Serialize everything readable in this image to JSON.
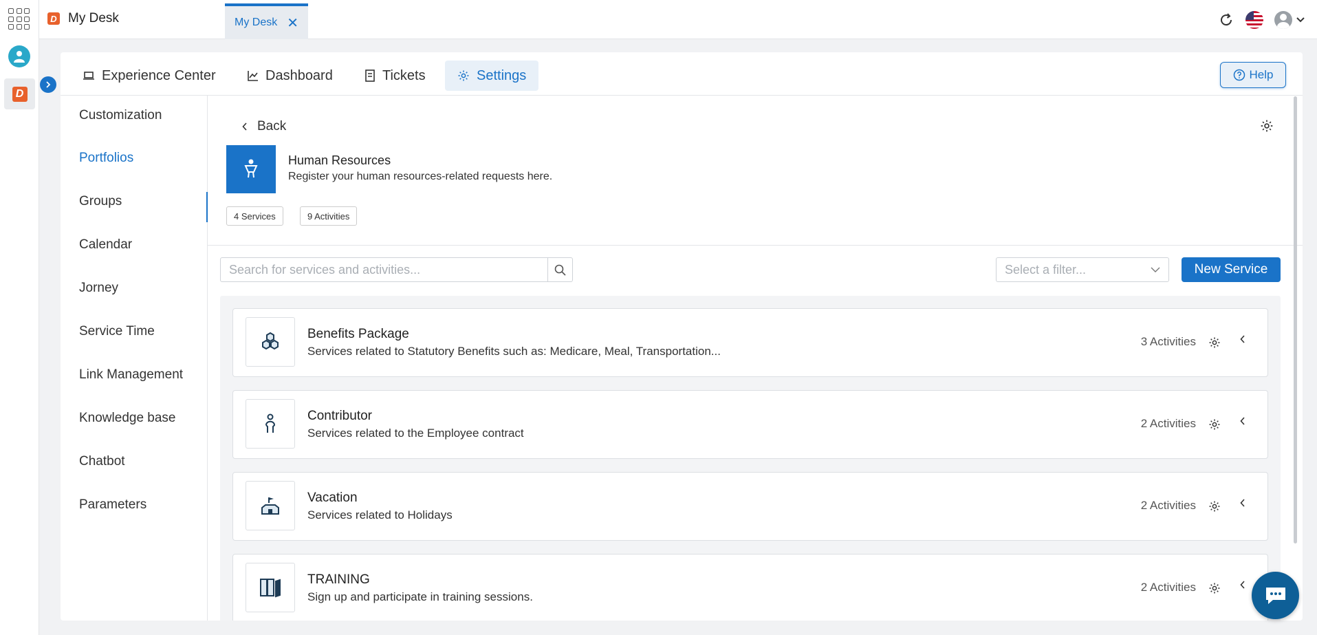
{
  "app": {
    "title": "My Desk",
    "tab_label": "My Desk"
  },
  "nav": {
    "items": [
      {
        "label": "Experience Center"
      },
      {
        "label": "Dashboard"
      },
      {
        "label": "Tickets"
      },
      {
        "label": "Settings"
      }
    ],
    "help_label": "Help"
  },
  "sidebar": {
    "items": [
      {
        "label": "Customization"
      },
      {
        "label": "Portfolios"
      },
      {
        "label": "Groups"
      },
      {
        "label": "Calendar"
      },
      {
        "label": "Jorney"
      },
      {
        "label": "Service Time"
      },
      {
        "label": "Link Management"
      },
      {
        "label": "Knowledge base"
      },
      {
        "label": "Chatbot"
      },
      {
        "label": "Parameters"
      }
    ],
    "active": "Portfolios"
  },
  "portfolio": {
    "back_label": "Back",
    "title": "Human Resources",
    "description": "Register your human resources-related requests here.",
    "services_badge": "4 Services",
    "activities_badge": "9 Activities"
  },
  "toolbar": {
    "search_placeholder": "Search for services and activities...",
    "filter_placeholder": "Select a filter...",
    "new_service_label": "New Service"
  },
  "services": [
    {
      "title": "Benefits Package",
      "description": "Services related to Statutory Benefits such as: Medicare, Meal, Transportation...",
      "activities": "3 Activities",
      "icon": "hexagons-icon"
    },
    {
      "title": "Contributor",
      "description": "Services related to the Employee contract",
      "activities": "2 Activities",
      "icon": "person-icon"
    },
    {
      "title": "Vacation",
      "description": "Services related to Holidays",
      "activities": "2 Activities",
      "icon": "building-flag-icon"
    },
    {
      "title": "TRAINING",
      "description": "Sign up and participate in training sessions.",
      "activities": "2 Activities",
      "icon": "books-icon"
    }
  ],
  "colors": {
    "accent": "#1a73c8",
    "brand": "#e8612c",
    "chat": "#0e5f97"
  }
}
